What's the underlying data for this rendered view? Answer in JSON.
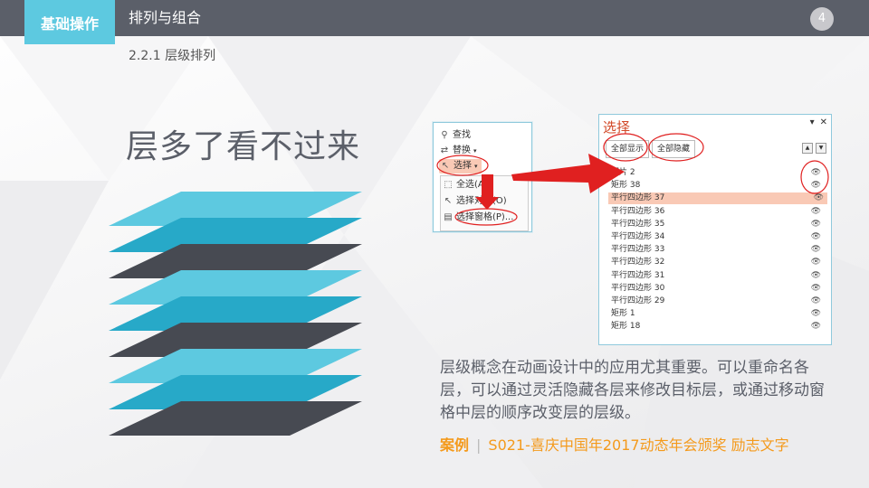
{
  "header": {
    "section_badge": "基础操作",
    "title": "排列与组合",
    "page_number": "4"
  },
  "subtitle": "2.2.1 层级排列",
  "headline": "层多了看不过来",
  "layer_colors": [
    "#5dc9e0",
    "#27a9c8",
    "#474a52"
  ],
  "ribbon_menu": {
    "find_label": "查找",
    "replace_label": "替换",
    "select_label": "选择",
    "dropdown_items": [
      {
        "label": "全选(A)",
        "icon": "select-all-icon"
      },
      {
        "label": "选择对象(O)",
        "icon": "cursor-icon"
      },
      {
        "label": "选择窗格(P)...",
        "icon": "selection-pane-icon"
      }
    ]
  },
  "selection_pane": {
    "title": "选择",
    "show_all": "全部显示",
    "hide_all": "全部隐藏",
    "items": [
      {
        "label": "图片 2",
        "selected": false
      },
      {
        "label": "矩形 38",
        "selected": false
      },
      {
        "label": "平行四边形 37",
        "selected": true
      },
      {
        "label": "平行四边形 36",
        "selected": false
      },
      {
        "label": "平行四边形 35",
        "selected": false
      },
      {
        "label": "平行四边形 34",
        "selected": false
      },
      {
        "label": "平行四边形 33",
        "selected": false
      },
      {
        "label": "平行四边形 32",
        "selected": false
      },
      {
        "label": "平行四边形 31",
        "selected": false
      },
      {
        "label": "平行四边形 30",
        "selected": false
      },
      {
        "label": "平行四边形 29",
        "selected": false
      },
      {
        "label": "矩形 1",
        "selected": false
      },
      {
        "label": "矩形 18",
        "selected": false
      }
    ]
  },
  "description": "层级概念在动画设计中的应用尤其重要。可以重命名各层，可以通过灵活隐藏各层来修改目标层，或通过移动窗格中层的顺序改变层的层级。",
  "case": {
    "label": "案例",
    "separator": "|",
    "text": "S021-喜庆中国年2017动态年会颁奖 励志文字"
  },
  "colors": {
    "topbar": "#5b5f69",
    "accent": "#5dc9e0",
    "highlight": "#f9c9b5",
    "annotation_red": "#e02020",
    "case_orange": "#f49a1c"
  }
}
